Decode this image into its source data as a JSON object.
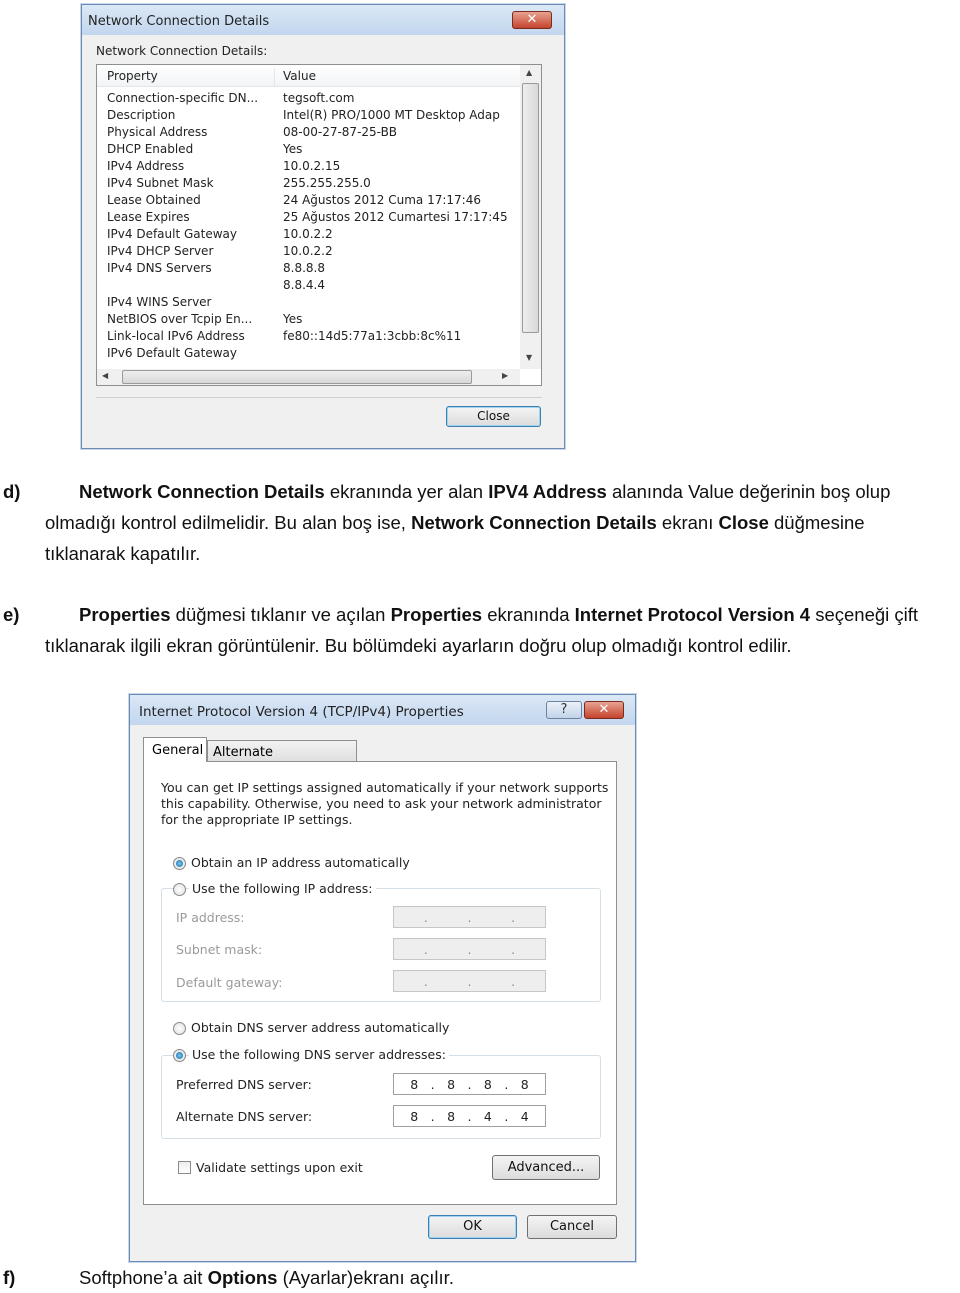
{
  "ncd": {
    "title": "Network Connection Details",
    "label": "Network Connection Details:",
    "col_property": "Property",
    "col_value": "Value",
    "close_label": "Close",
    "close_icon": "x-icon",
    "rows": [
      {
        "p": "Connection-specific DN...",
        "v": "tegsoft.com"
      },
      {
        "p": "Description",
        "v": "Intel(R) PRO/1000 MT Desktop Adap"
      },
      {
        "p": "Physical Address",
        "v": "08-00-27-87-25-BB"
      },
      {
        "p": "DHCP Enabled",
        "v": "Yes"
      },
      {
        "p": "IPv4 Address",
        "v": "10.0.2.15"
      },
      {
        "p": "IPv4 Subnet Mask",
        "v": "255.255.255.0"
      },
      {
        "p": "Lease Obtained",
        "v": "24 Ağustos 2012 Cuma 17:17:46"
      },
      {
        "p": "Lease Expires",
        "v": "25 Ağustos 2012 Cumartesi 17:17:45"
      },
      {
        "p": "IPv4 Default Gateway",
        "v": "10.0.2.2"
      },
      {
        "p": "IPv4 DHCP Server",
        "v": "10.0.2.2"
      },
      {
        "p": "IPv4 DNS Servers",
        "v": "8.8.8.8"
      },
      {
        "p": "",
        "v": "8.8.4.4"
      },
      {
        "p": "IPv4 WINS Server",
        "v": ""
      },
      {
        "p": "NetBIOS over Tcpip En...",
        "v": "Yes"
      },
      {
        "p": "Link-local IPv6 Address",
        "v": "fe80::14d5:77a1:3cbb:8c%11"
      },
      {
        "p": "IPv6 Default Gateway",
        "v": ""
      }
    ]
  },
  "text": {
    "d_marker": "d)",
    "d1a": "Network Connection Details",
    "d1b": " ekranında yer alan ",
    "d1c": "IPV4 Address",
    "d1d": " alanında Value değerinin boş olup",
    "d2a": "olmadığı kontrol edilmelidir. Bu alan boş ise, ",
    "d2b": "Network Connection Details",
    "d2c": " ekranı ",
    "d2d": "Close",
    "d2e": " düğmesine",
    "d3": "tıklanarak kapatılır.",
    "e_marker": "e)",
    "e1a": "Properties",
    "e1b": " düğmesi tıklanır ve açılan ",
    "e1c": "Properties",
    "e1d": " ekranında ",
    "e1e": "Internet Protocol Version 4",
    "e1f": " seçeneği çift",
    "e2": "tıklanarak ilgili ekran görüntülenir. Bu bölümdeki ayarların doğru olup olmadığı kontrol edilir.",
    "f_marker": "f)",
    "f1a": "Softphone’a ait ",
    "f1b": "Options",
    "f1c": " (Ayarlar)ekranı açılır."
  },
  "ipv4": {
    "title": "Internet Protocol Version 4 (TCP/IPv4) Properties",
    "help": "?",
    "close": "✕",
    "tabs": [
      "General",
      "Alternate Configuration"
    ],
    "intro": [
      "You can get IP settings assigned automatically if your network supports",
      "this capability. Otherwise, you need to ask your network administrator",
      "for the appropriate IP settings."
    ],
    "ip_auto": "Obtain an IP address automatically",
    "ip_manual": "Use the following IP address:",
    "ip_mode": "automatic",
    "ip_address": "IP address:",
    "subnet": "Subnet mask:",
    "gateway": "Default gateway:",
    "dns_auto": "Obtain DNS server address automatically",
    "dns_manual": "Use the following DNS server addresses:",
    "dns_mode": "manual",
    "preferred": "Preferred DNS server:",
    "alternate": "Alternate DNS server:",
    "preferred_octets": [
      "8",
      "8",
      "8",
      "8"
    ],
    "alternate_octets": [
      "8",
      "8",
      "4",
      "4"
    ],
    "validate": "Validate settings upon exit",
    "validate_checked": false,
    "advanced": "Advanced...",
    "ok": "OK",
    "cancel": "Cancel"
  }
}
